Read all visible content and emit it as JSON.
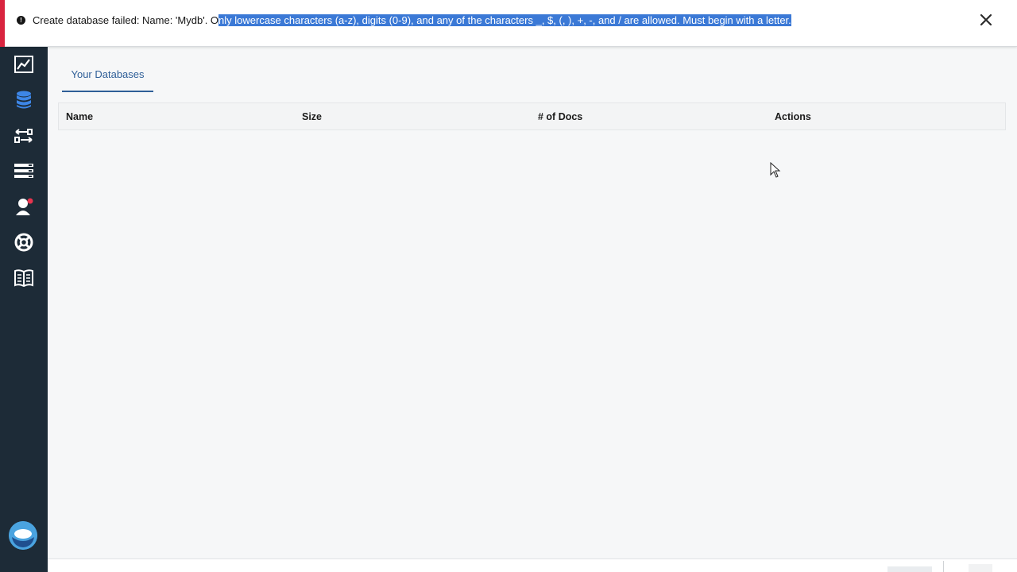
{
  "alert": {
    "message_prefix": "Create database failed: Name: 'Mydb'. O",
    "message_selected": "nly lowercase characters (a-z), digits (0-9), and any of the characters _, $, (, ), +, -, and / are allowed. Must begin with a letter.",
    "icon": "error-icon",
    "close_icon": "close-icon",
    "accent_color": "#d9243f"
  },
  "sidebar": {
    "items": [
      {
        "name": "monitoring-icon"
      },
      {
        "name": "databases-icon"
      },
      {
        "name": "replication-icon"
      },
      {
        "name": "active-tasks-icon"
      },
      {
        "name": "account-icon"
      },
      {
        "name": "support-icon"
      },
      {
        "name": "documentation-icon"
      }
    ],
    "logo": "cloudant-logo"
  },
  "main": {
    "tab_label": "Your Databases",
    "columns": [
      "Name",
      "Size",
      "# of Docs",
      "Actions"
    ]
  },
  "colors": {
    "sidebar_bg": "#1d2b37",
    "tab_accent": "#2f5f98",
    "selection": "#3b79d6"
  }
}
